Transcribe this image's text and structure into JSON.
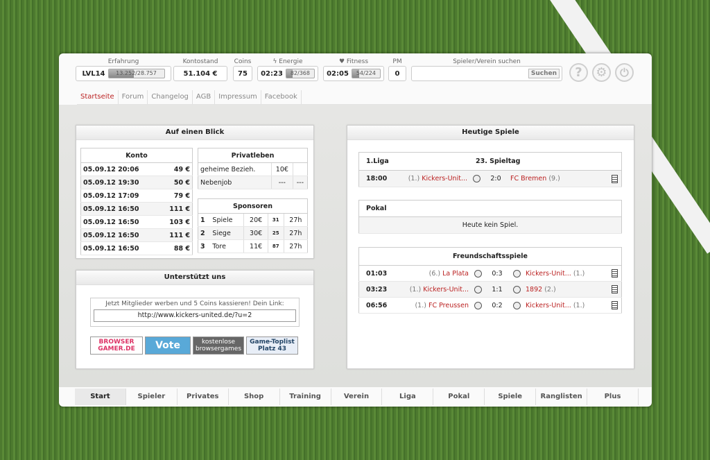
{
  "stats": {
    "erfahrung": {
      "label": "Erfahrung",
      "level": "LVL14",
      "progress_text": "13.252/28.757",
      "progress": 0.46
    },
    "kontostand": {
      "label": "Kontostand",
      "value": "51.104 €"
    },
    "coins": {
      "label": "Coins",
      "value": "75"
    },
    "energie": {
      "label": "Energie",
      "icon": "bolt-icon",
      "time": "02:23",
      "progress_text": "82/368",
      "progress": 0.22
    },
    "fitness": {
      "label": "Fitness",
      "icon": "heart-icon",
      "time": "02:05",
      "progress_text": "54/224",
      "progress": 0.24
    },
    "pm": {
      "label": "PM",
      "value": "0"
    },
    "search": {
      "label": "Spieler/Verein suchen",
      "placeholder": "",
      "button": "Suchen"
    }
  },
  "icons": {
    "help": "?",
    "settings": "⚙",
    "power": "⏻"
  },
  "topnav": [
    "Startseite",
    "Forum",
    "Changelog",
    "AGB",
    "Impressum",
    "Facebook"
  ],
  "blick": {
    "title": "Auf einen Blick",
    "konto": {
      "title": "Konto",
      "rows": [
        [
          "05.09.12 20:06",
          "49 €"
        ],
        [
          "05.09.12 19:30",
          "50 €"
        ],
        [
          "05.09.12 17:09",
          "79 €"
        ],
        [
          "05.09.12 16:50",
          "111 €"
        ],
        [
          "05.09.12 16:50",
          "103 €"
        ],
        [
          "05.09.12 16:50",
          "111 €"
        ],
        [
          "05.09.12 16:50",
          "88 €"
        ]
      ]
    },
    "privat": {
      "title": "Privatleben",
      "rows": [
        [
          "geheime Bezieh.",
          "10€",
          ""
        ],
        [
          "Nebenjob",
          "---",
          "---"
        ]
      ]
    },
    "sponsoren": {
      "title": "Sponsoren",
      "rows": [
        [
          "1",
          "Spiele",
          "20€",
          "31",
          "27h"
        ],
        [
          "2",
          "Siege",
          "30€",
          "25",
          "27h"
        ],
        [
          "3",
          "Tore",
          "11€",
          "87",
          "27h"
        ]
      ]
    }
  },
  "support": {
    "title": "Unterstützt uns",
    "text": "Jetzt Mitglieder werben und 5 Coins kassieren! Dein Link:",
    "link": "http://www.kickers-united.de/?u=2",
    "banners": {
      "bg1": "BROWSER",
      "bg2": "GAMER.DE",
      "vote": "Vote",
      "kb1": "kostenlose",
      "kb2": "browsergames",
      "gt1": "Game-Toplist",
      "gt2": "Platz 43"
    }
  },
  "heute": {
    "title": "Heutige Spiele",
    "liga": {
      "name": "1.Liga",
      "spieltag": "23. Spieltag",
      "time": "18:00",
      "home_rank": "(1.)",
      "home": "Kickers-Unit...",
      "score": "2:0",
      "away": "FC Bremen",
      "away_rank": "(9.)"
    },
    "pokal": {
      "name": "Pokal",
      "text": "Heute kein Spiel."
    },
    "freund": {
      "title": "Freundschaftsspiele",
      "rows": [
        {
          "time": "01:03",
          "home_rank": "(6.)",
          "home": "La Plata",
          "score": "0:3",
          "away": "Kickers-Unit...",
          "away_rank": "(1.)"
        },
        {
          "time": "03:23",
          "home_rank": "(1.)",
          "home": "Kickers-Unit...",
          "score": "1:1",
          "away": "1892",
          "away_rank": "(2.)"
        },
        {
          "time": "06:56",
          "home_rank": "(1.)",
          "home": "FC Preussen",
          "score": "0:2",
          "away": "Kickers-Unit...",
          "away_rank": "(1.)"
        }
      ]
    }
  },
  "botnav": [
    "Start",
    "Spieler",
    "Privates",
    "Shop",
    "Training",
    "Verein",
    "Liga",
    "Pokal",
    "Spiele",
    "Ranglisten",
    "Plus"
  ]
}
